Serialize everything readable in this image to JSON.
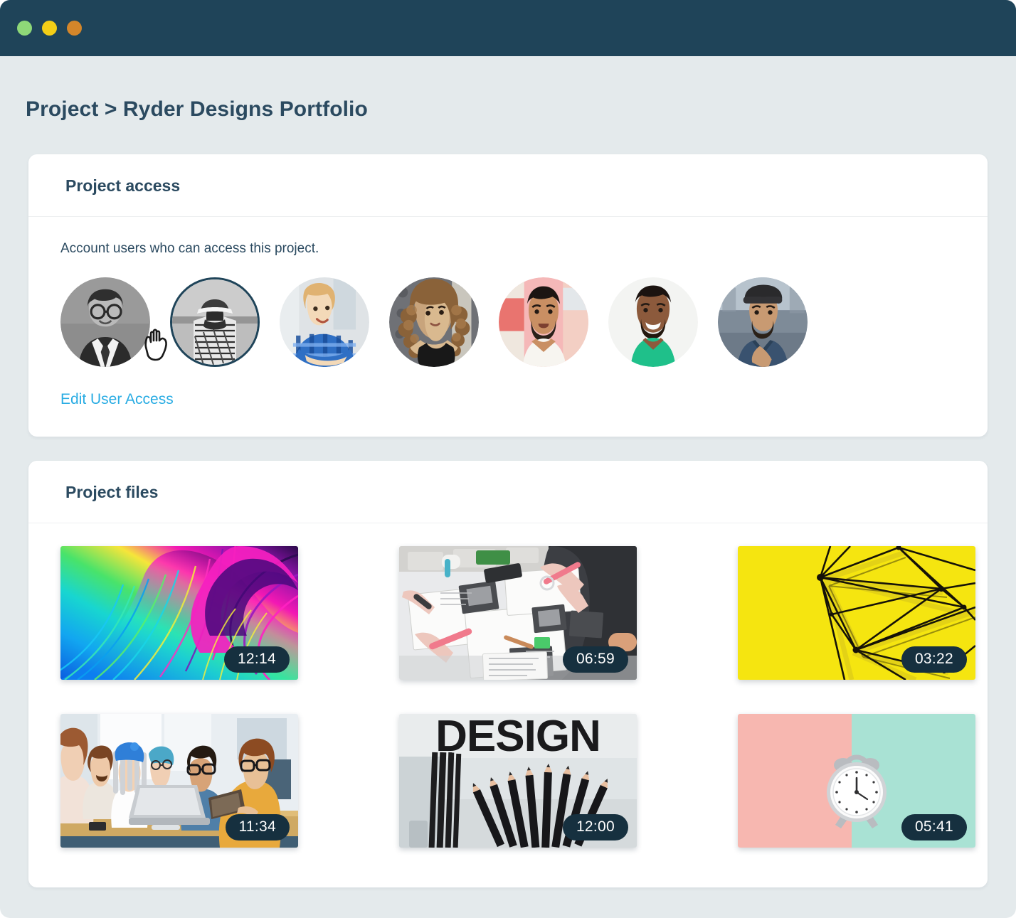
{
  "window": {
    "traffic_lights": [
      {
        "name": "close-button",
        "color": "#8ed878"
      },
      {
        "name": "minimize-button",
        "color": "#f3ce17"
      },
      {
        "name": "maximize-button",
        "color": "#d4862a"
      }
    ],
    "titlebar_color": "#1f4459",
    "page_background": "#e4eaec"
  },
  "breadcrumb": {
    "text": "Project > Ryder Designs Portfolio",
    "parent": "Project",
    "separator": ">",
    "current": "Ryder Designs Portfolio",
    "color": "#2b4a60"
  },
  "access_card": {
    "title": "Project access",
    "description": "Account users who can access this project.",
    "edit_link_label": "Edit User Access",
    "edit_link_color": "#29ace3",
    "selected_index": 1,
    "cursor_icon": "pointing-hand-cursor",
    "avatars": [
      {
        "name": "avatar-user-1",
        "alt": "Man in suit with glasses smiling",
        "grayscale": true,
        "selected": false
      },
      {
        "name": "avatar-user-2",
        "alt": "Person in cap viewed from behind",
        "grayscale": true,
        "selected": true
      },
      {
        "name": "avatar-user-3",
        "alt": "Woman in blue plaid shirt",
        "grayscale": false,
        "selected": false
      },
      {
        "name": "avatar-user-4",
        "alt": "Woman with curly hair",
        "grayscale": false,
        "selected": false
      },
      {
        "name": "avatar-user-5",
        "alt": "Man in white shirt with beard",
        "grayscale": false,
        "selected": false
      },
      {
        "name": "avatar-user-6",
        "alt": "Man in green t-shirt smiling",
        "grayscale": false,
        "selected": false
      },
      {
        "name": "avatar-user-7",
        "alt": "Man in beanie and denim jacket",
        "grayscale": false,
        "selected": false
      }
    ]
  },
  "files_card": {
    "title": "Project files",
    "badge_background": "#16303f",
    "badge_text_color": "#ffffff",
    "files": [
      {
        "name": "file-thumbnail-1",
        "duration": "12:14",
        "thumb": "colorful-paint-swirl",
        "alt": "Vibrant cyan magenta and purple paint swirl"
      },
      {
        "name": "file-thumbnail-2",
        "duration": "06:59",
        "thumb": "design-desk-workspace",
        "alt": "Designers hands working over a desk of photos and pens"
      },
      {
        "name": "file-thumbnail-3",
        "duration": "03:22",
        "thumb": "yellow-wireframe",
        "alt": "Black geometric wireframe lines on bright yellow"
      },
      {
        "name": "file-thumbnail-4",
        "duration": "11:34",
        "thumb": "team-meeting",
        "alt": "Group of people gathered around a laptop"
      },
      {
        "name": "file-thumbnail-5",
        "duration": "12:00",
        "thumb": "design-pencils",
        "alt": "The word DESIGN above a fan of black pencils"
      },
      {
        "name": "file-thumbnail-6",
        "duration": "05:41",
        "thumb": "pink-mint-clock",
        "alt": "White alarm clock on split pink and mint background"
      }
    ]
  }
}
